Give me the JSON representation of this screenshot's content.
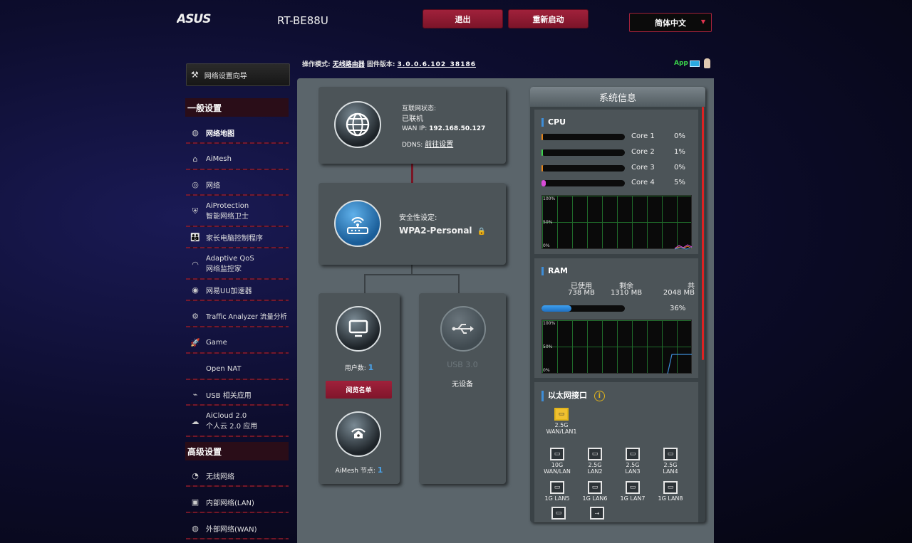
{
  "header": {
    "model": "RT-BE88U",
    "logout_label": "退出",
    "reboot_label": "重新启动",
    "language": "简体中文"
  },
  "status_line": {
    "opmode_label": "操作模式:",
    "opmode_value": "无线路由器",
    "firmware_label": "固件版本:",
    "firmware_value": "3.0.0.6.102_38186",
    "app_label": "App"
  },
  "sidebar": {
    "qis_label": "网络设置向导",
    "general_header": "一般设置",
    "advanced_header": "高级设置",
    "items": [
      {
        "label": "网络地图",
        "icon": "network-map-icon"
      },
      {
        "label": "AiMesh",
        "icon": "aimesh-icon"
      },
      {
        "label": "网络",
        "icon": "network-icon"
      },
      {
        "label": "AiProtection",
        "sub": "智能网络卫士",
        "icon": "shield-icon"
      },
      {
        "label": "家长电脑控制程序",
        "icon": "parental-icon"
      },
      {
        "label": "Adaptive QoS",
        "sub": "网络监控家",
        "icon": "qos-gauge-icon"
      },
      {
        "label": "网易UU加速器",
        "icon": "uu-icon"
      },
      {
        "label": "Traffic Analyzer 流量分析",
        "icon": "traffic-icon"
      },
      {
        "label": "Game",
        "icon": "rocket-icon"
      },
      {
        "label": "Open NAT",
        "icon": ""
      },
      {
        "label": "USB 相关应用",
        "icon": "usb-icon"
      },
      {
        "label": "AiCloud 2.0",
        "sub": "个人云 2.0 应用",
        "icon": "cloud-icon"
      }
    ],
    "advanced_items": [
      {
        "label": "无线网络",
        "icon": "wireless-icon"
      },
      {
        "label": "内部网络(LAN)",
        "icon": "lan-icon"
      },
      {
        "label": "外部网络(WAN)",
        "icon": "wan-globe-icon"
      }
    ]
  },
  "network_map": {
    "internet": {
      "status_label": "互联网状态:",
      "status_value": "已联机",
      "wan_ip_label": "WAN IP:",
      "wan_ip_value": "192.168.50.127",
      "ddns_label": "DDNS:",
      "ddns_link": "前往设置"
    },
    "router": {
      "security_label": "安全性设定:",
      "security_value": "WPA2-Personal"
    },
    "clients": {
      "label": "用户数:",
      "count": "1",
      "button": "阅览名单"
    },
    "aimesh": {
      "label": "AiMesh 节点:",
      "count": "1"
    },
    "usb": {
      "label": "USB 3.0",
      "status": "无设备"
    }
  },
  "system_info": {
    "title": "系统信息",
    "cpu_title": "CPU",
    "cores": [
      {
        "label": "Core 1",
        "pct_text": "0%",
        "pct": 0,
        "color": "#e3831a"
      },
      {
        "label": "Core 2",
        "pct_text": "1%",
        "pct": 1,
        "color": "#3ad34a"
      },
      {
        "label": "Core 3",
        "pct_text": "0%",
        "pct": 0,
        "color": "#e3831a"
      },
      {
        "label": "Core 4",
        "pct_text": "5%",
        "pct": 5,
        "color": "#d94bd9"
      }
    ],
    "graph_labels": {
      "top": "100%",
      "mid": "50%",
      "bottom": "0%"
    },
    "ram_title": "RAM",
    "ram": {
      "used_label": "已使用",
      "used_value": "738 MB",
      "free_label": "剩余",
      "free_value": "1310 MB",
      "total_label": "共",
      "total_value": "2048 MB",
      "pct_text": "36%",
      "pct": 36
    },
    "ethernet_title": "以太网接口",
    "ports": [
      {
        "line1": "2.5G",
        "line2": "WAN/LAN1",
        "active": true
      },
      {
        "line1": "10G",
        "line2": "WAN/LAN",
        "active": false
      },
      {
        "line1": "2.5G",
        "line2": "LAN2",
        "active": false
      },
      {
        "line1": "2.5G",
        "line2": "LAN3",
        "active": false
      },
      {
        "line1": "2.5G",
        "line2": "LAN4",
        "active": false
      },
      {
        "line1": "1G LAN5",
        "line2": "",
        "active": false
      },
      {
        "line1": "1G LAN6",
        "line2": "",
        "active": false
      },
      {
        "line1": "1G LAN7",
        "line2": "",
        "active": false
      },
      {
        "line1": "1G LAN8",
        "line2": "",
        "active": false
      }
    ]
  }
}
